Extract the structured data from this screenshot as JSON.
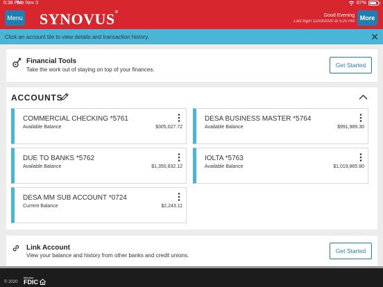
{
  "status_bar": {
    "time": "5:38 PM",
    "date": "Tue Nov 3",
    "battery": "87%"
  },
  "header": {
    "menu_label": "Menu",
    "logo_text": "SYNOVUS",
    "logo_mark": "®",
    "greeting": "Good Evening",
    "last_login": "Last login 11/03/2020 at 5:25 PM",
    "more_label": "More"
  },
  "banner": {
    "text": "Click an account tile to view details and transaction history."
  },
  "financial_tools": {
    "title": "Financial Tools",
    "subtitle": "Take the work out of staying on top of your finances.",
    "button": "Get Started"
  },
  "accounts": {
    "title": "ACCOUNTS",
    "items": [
      {
        "name": "COMMERCIAL CHECKING *5761",
        "balance_label": "Available Balance",
        "balance": "$305,027.72"
      },
      {
        "name": "DESA BUSINESS MASTER *5764",
        "balance_label": "Available Balance",
        "balance": "$991,989.30"
      },
      {
        "name": "DUE TO BANKS *5762",
        "balance_label": "Available Balance",
        "balance": "$1,350,832.12"
      },
      {
        "name": "IOLTA *5763",
        "balance_label": "Available Balance",
        "balance": "$1,019,865.80"
      },
      {
        "name": "DESA MM SUB ACCOUNT *0724",
        "balance_label": "Current Balance",
        "balance": "$2,243.11"
      }
    ]
  },
  "link_account": {
    "title": "Link Account",
    "subtitle": "View your balance and history from other banks and credit unions.",
    "button": "Get Started"
  },
  "footer": {
    "copyright": "© 2020",
    "fdic_member": "Member",
    "fdic": "FDIC"
  },
  "colors": {
    "brand_red": "#d7262e",
    "accent_blue": "#1e7fb5",
    "banner_blue": "#4ab5d4"
  },
  "icons": [
    "wifi-icon",
    "battery-icon",
    "close-icon",
    "tools-icon",
    "pencil-icon",
    "chevron-up-icon",
    "kebab-icon",
    "link-icon",
    "equal-housing-icon"
  ]
}
